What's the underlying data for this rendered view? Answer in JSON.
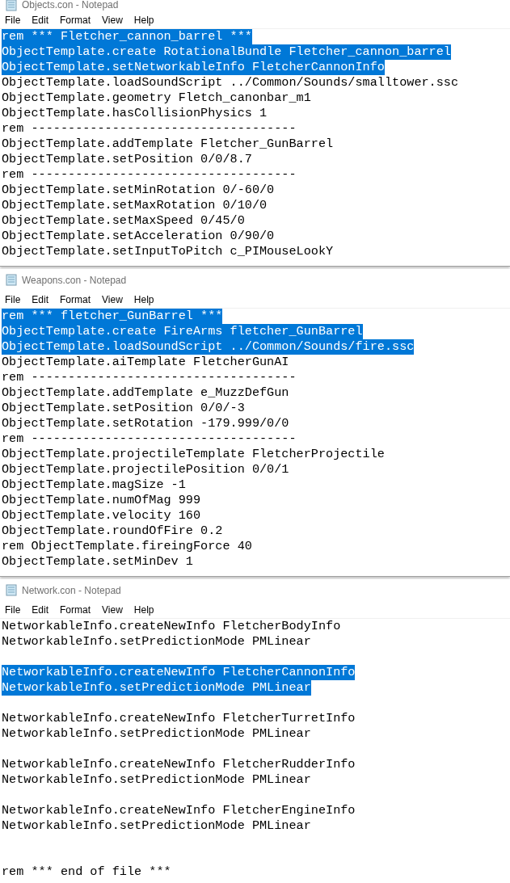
{
  "windows": [
    {
      "title": "Objects.con - Notepad",
      "menu": [
        "File",
        "Edit",
        "Format",
        "View",
        "Help"
      ],
      "lines": [
        {
          "kind": "text",
          "text": "rem *** Fletcher_cannon_barrel ***",
          "selected": true
        },
        {
          "kind": "text",
          "text": "ObjectTemplate.create RotationalBundle Fletcher_cannon_barrel",
          "selected": true
        },
        {
          "kind": "text",
          "text": "ObjectTemplate.setNetworkableInfo FletcherCannonInfo",
          "selected": true
        },
        {
          "kind": "text",
          "text": "ObjectTemplate.loadSoundScript ../Common/Sounds/smalltower.ssc",
          "selected": false
        },
        {
          "kind": "text",
          "text": "ObjectTemplate.geometry Fletch_canonbar_m1",
          "selected": false
        },
        {
          "kind": "text",
          "text": "ObjectTemplate.hasCollisionPhysics 1",
          "selected": false
        },
        {
          "kind": "text",
          "text": "rem ------------------------------------",
          "selected": false
        },
        {
          "kind": "text",
          "text": "ObjectTemplate.addTemplate Fletcher_GunBarrel",
          "selected": false
        },
        {
          "kind": "text",
          "text": "ObjectTemplate.setPosition 0/0/8.7",
          "selected": false
        },
        {
          "kind": "text",
          "text": "rem ------------------------------------",
          "selected": false
        },
        {
          "kind": "text",
          "text": "ObjectTemplate.setMinRotation 0/-60/0",
          "selected": false
        },
        {
          "kind": "text",
          "text": "ObjectTemplate.setMaxRotation 0/10/0",
          "selected": false
        },
        {
          "kind": "text",
          "text": "ObjectTemplate.setMaxSpeed 0/45/0",
          "selected": false
        },
        {
          "kind": "text",
          "text": "ObjectTemplate.setAcceleration 0/90/0",
          "selected": false
        },
        {
          "kind": "text",
          "text": "ObjectTemplate.setInputToPitch c_PIMouseLookY",
          "selected": false
        }
      ]
    },
    {
      "title": "Weapons.con - Notepad",
      "menu": [
        "File",
        "Edit",
        "Format",
        "View",
        "Help"
      ],
      "lines": [
        {
          "kind": "text",
          "text": "rem *** fletcher_GunBarrel ***",
          "selected": true
        },
        {
          "kind": "text",
          "text": "ObjectTemplate.create FireArms fletcher_GunBarrel",
          "selected": true
        },
        {
          "kind": "text",
          "text": "ObjectTemplate.loadSoundScript ../Common/Sounds/fire.ssc",
          "selected": true
        },
        {
          "kind": "text",
          "text": "ObjectTemplate.aiTemplate FletcherGunAI",
          "selected": false
        },
        {
          "kind": "text",
          "text": "rem ------------------------------------",
          "selected": false
        },
        {
          "kind": "text",
          "text": "ObjectTemplate.addTemplate e_MuzzDefGun",
          "selected": false
        },
        {
          "kind": "text",
          "text": "ObjectTemplate.setPosition 0/0/-3",
          "selected": false
        },
        {
          "kind": "text",
          "text": "ObjectTemplate.setRotation -179.999/0/0",
          "selected": false
        },
        {
          "kind": "text",
          "text": "rem ------------------------------------",
          "selected": false
        },
        {
          "kind": "text",
          "text": "ObjectTemplate.projectileTemplate FletcherProjectile",
          "selected": false
        },
        {
          "kind": "text",
          "text": "ObjectTemplate.projectilePosition 0/0/1",
          "selected": false
        },
        {
          "kind": "text",
          "text": "ObjectTemplate.magSize -1",
          "selected": false
        },
        {
          "kind": "text",
          "text": "ObjectTemplate.numOfMag 999",
          "selected": false
        },
        {
          "kind": "text",
          "text": "ObjectTemplate.velocity 160",
          "selected": false
        },
        {
          "kind": "text",
          "text": "ObjectTemplate.roundOfFire 0.2",
          "selected": false
        },
        {
          "kind": "text",
          "text": "rem ObjectTemplate.fireingForce 40",
          "selected": false
        },
        {
          "kind": "text",
          "text": "ObjectTemplate.setMinDev 1",
          "selected": false
        }
      ]
    },
    {
      "title": "Network.con - Notepad",
      "menu": [
        "File",
        "Edit",
        "Format",
        "View",
        "Help"
      ],
      "lines": [
        {
          "kind": "text",
          "text": "NetworkableInfo.createNewInfo FletcherBodyInfo",
          "selected": false
        },
        {
          "kind": "text",
          "text": "NetworkableInfo.setPredictionMode PMLinear",
          "selected": false
        },
        {
          "kind": "blank"
        },
        {
          "kind": "text",
          "text": "NetworkableInfo.createNewInfo FletcherCannonInfo",
          "selected": true
        },
        {
          "kind": "text",
          "text": "NetworkableInfo.setPredictionMode PMLinear",
          "selected": true
        },
        {
          "kind": "blank"
        },
        {
          "kind": "text",
          "text": "NetworkableInfo.createNewInfo FletcherTurretInfo",
          "selected": false
        },
        {
          "kind": "text",
          "text": "NetworkableInfo.setPredictionMode PMLinear",
          "selected": false
        },
        {
          "kind": "blank"
        },
        {
          "kind": "text",
          "text": "NetworkableInfo.createNewInfo FletcherRudderInfo",
          "selected": false
        },
        {
          "kind": "text",
          "text": "NetworkableInfo.setPredictionMode PMLinear",
          "selected": false
        },
        {
          "kind": "blank"
        },
        {
          "kind": "text",
          "text": "NetworkableInfo.createNewInfo FletcherEngineInfo",
          "selected": false
        },
        {
          "kind": "text",
          "text": "NetworkableInfo.setPredictionMode PMLinear",
          "selected": false
        },
        {
          "kind": "blank"
        },
        {
          "kind": "blank"
        },
        {
          "kind": "text",
          "text": "rem *** end of file ***",
          "selected": false
        }
      ]
    }
  ]
}
